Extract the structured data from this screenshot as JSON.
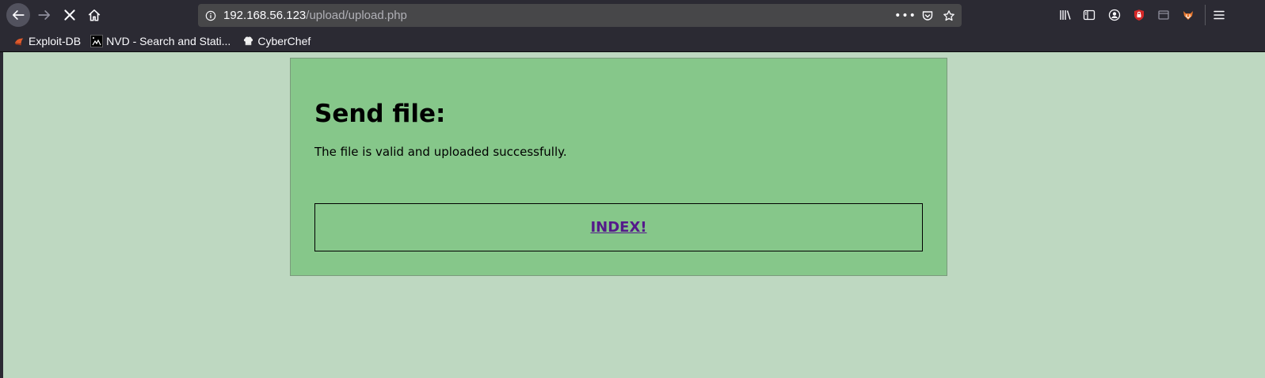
{
  "browser": {
    "url_host": "192.168.56.123",
    "url_path": "/upload/upload.php",
    "page_actions_glyph": "•••",
    "bookmarks": [
      {
        "label": "Exploit-DB",
        "icon": "exploit-db-icon"
      },
      {
        "label": "NVD - Search and Stati...",
        "icon": "nvd-icon"
      },
      {
        "label": "CyberChef",
        "icon": "cyberchef-icon"
      }
    ]
  },
  "page": {
    "title": "Send file:",
    "message": "The file is valid and uploaded successfully.",
    "index_link": "INDEX!"
  },
  "colors": {
    "page_background": "#bed8c1",
    "card_background": "#86c78a",
    "link": "#551a8b"
  }
}
